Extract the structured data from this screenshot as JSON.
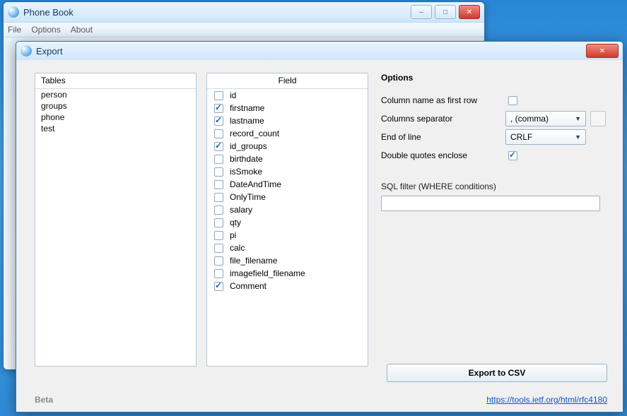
{
  "parent_window": {
    "title": "Phone Book",
    "menu": [
      "File",
      "Options",
      "About"
    ],
    "buttons": {
      "min": "–",
      "max": "□",
      "close": "✕"
    }
  },
  "dialog": {
    "title": "Export",
    "close": "✕",
    "tables": {
      "header": "Tables",
      "items": [
        "person",
        "groups",
        "phone",
        "test"
      ]
    },
    "fields": {
      "header": "Field",
      "items": [
        {
          "name": "id",
          "checked": false
        },
        {
          "name": "firstname",
          "checked": true
        },
        {
          "name": "lastname",
          "checked": true
        },
        {
          "name": "record_count",
          "checked": false
        },
        {
          "name": "id_groups",
          "checked": true
        },
        {
          "name": "birthdate",
          "checked": false
        },
        {
          "name": "isSmoke",
          "checked": false
        },
        {
          "name": "DateAndTime",
          "checked": false
        },
        {
          "name": "OnlyTime",
          "checked": false
        },
        {
          "name": "salary",
          "checked": false
        },
        {
          "name": "qty",
          "checked": false
        },
        {
          "name": "pi",
          "checked": false
        },
        {
          "name": "calc",
          "checked": false
        },
        {
          "name": "file_filename",
          "checked": false
        },
        {
          "name": "imagefield_filename",
          "checked": false
        },
        {
          "name": "Comment",
          "checked": true
        }
      ]
    },
    "options": {
      "heading": "Options",
      "col_first_row": {
        "label": "Column name as first row",
        "checked": false
      },
      "separator": {
        "label": "Columns separator",
        "value": ", (comma)"
      },
      "eol": {
        "label": "End of line",
        "value": "CRLF"
      },
      "quotes": {
        "label": "Double quotes enclose",
        "checked": true
      },
      "sql_label": "SQL filter (WHERE conditions)",
      "sql_value": ""
    },
    "export_button": "Export to CSV",
    "footer": "Beta",
    "link": "https://tools.ietf.org/html/rfc4180"
  }
}
